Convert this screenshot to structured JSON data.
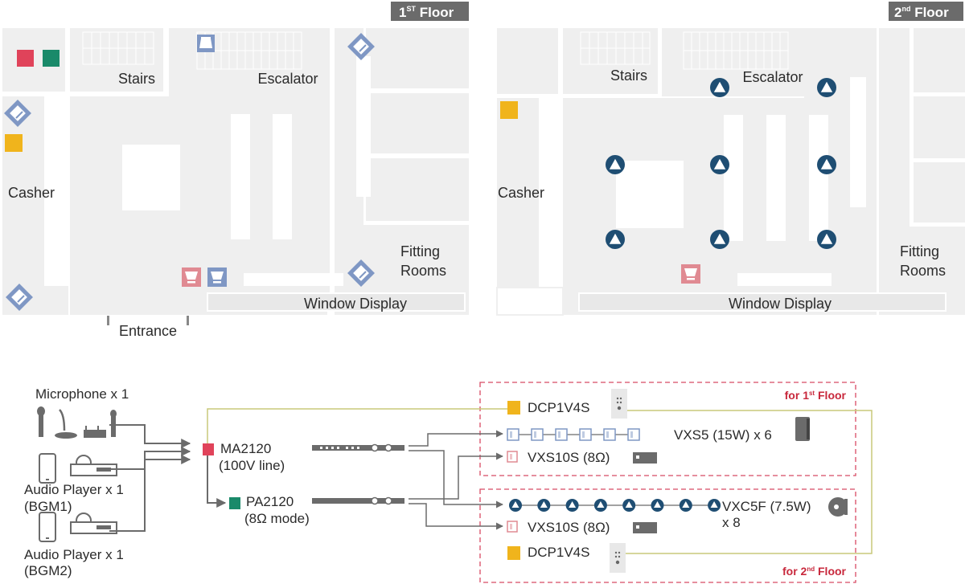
{
  "colors": {
    "floor_bg": "#efefef",
    "wall": "#ffffff",
    "badge_bg": "#6b6b6b",
    "ma_red": "#e0435a",
    "pa_green": "#1a8a6a",
    "dcp_yellow": "#f0b41c",
    "vxs5_blue": "#7f97c4",
    "vxs10_pink": "#e08a92",
    "ceiling_navy": "#1f4e73",
    "control_line": "#c9c97a",
    "group_border": "#d84a64",
    "wire": "#6b6b6b"
  },
  "floor1": {
    "badge_main": "1",
    "badge_sup": "ST",
    "badge_rest": " Floor",
    "labels": {
      "stairs": "Stairs",
      "escalator": "Escalator",
      "casher": "Casher",
      "fitting_1": "Fitting",
      "fitting_2": "Rooms",
      "window_display": "Window Display",
      "entrance": "Entrance"
    }
  },
  "floor2": {
    "badge_main": "2",
    "badge_sup": "nd",
    "badge_rest": " Floor",
    "labels": {
      "stairs": "Stairs",
      "escalator": "Escalator",
      "casher": "Casher",
      "fitting_1": "Fitting",
      "fitting_2": "Rooms",
      "window_display": "Window Display"
    }
  },
  "diagram": {
    "sources": {
      "microphone": "Microphone x 1",
      "player1_line1": "Audio Player x 1",
      "player1_line2": "(BGM1)",
      "player2_line1": "Audio Player x 1",
      "player2_line2": "(BGM2)"
    },
    "amps": {
      "ma_name": "MA2120",
      "ma_mode": "(100V line)",
      "pa_name": "PA2120",
      "pa_mode": "(8Ω mode)"
    },
    "group1": {
      "title_main": "for 1",
      "title_sup": "st",
      "title_rest": " Floor",
      "dcp": "DCP1V4S",
      "vxs5": "VXS5 (15W) x 6",
      "vxs5_count": 6,
      "vxs10": "VXS10S (8Ω)"
    },
    "group2": {
      "title_main": "for 2",
      "title_sup": "nd",
      "title_rest": " Floor",
      "dcp": "DCP1V4S",
      "vxc5f": "VXC5F (7.5W)",
      "vxc5f_count_label": "x 8",
      "vxc5f_count": 8,
      "vxs10": "VXS10S (8Ω)"
    }
  }
}
